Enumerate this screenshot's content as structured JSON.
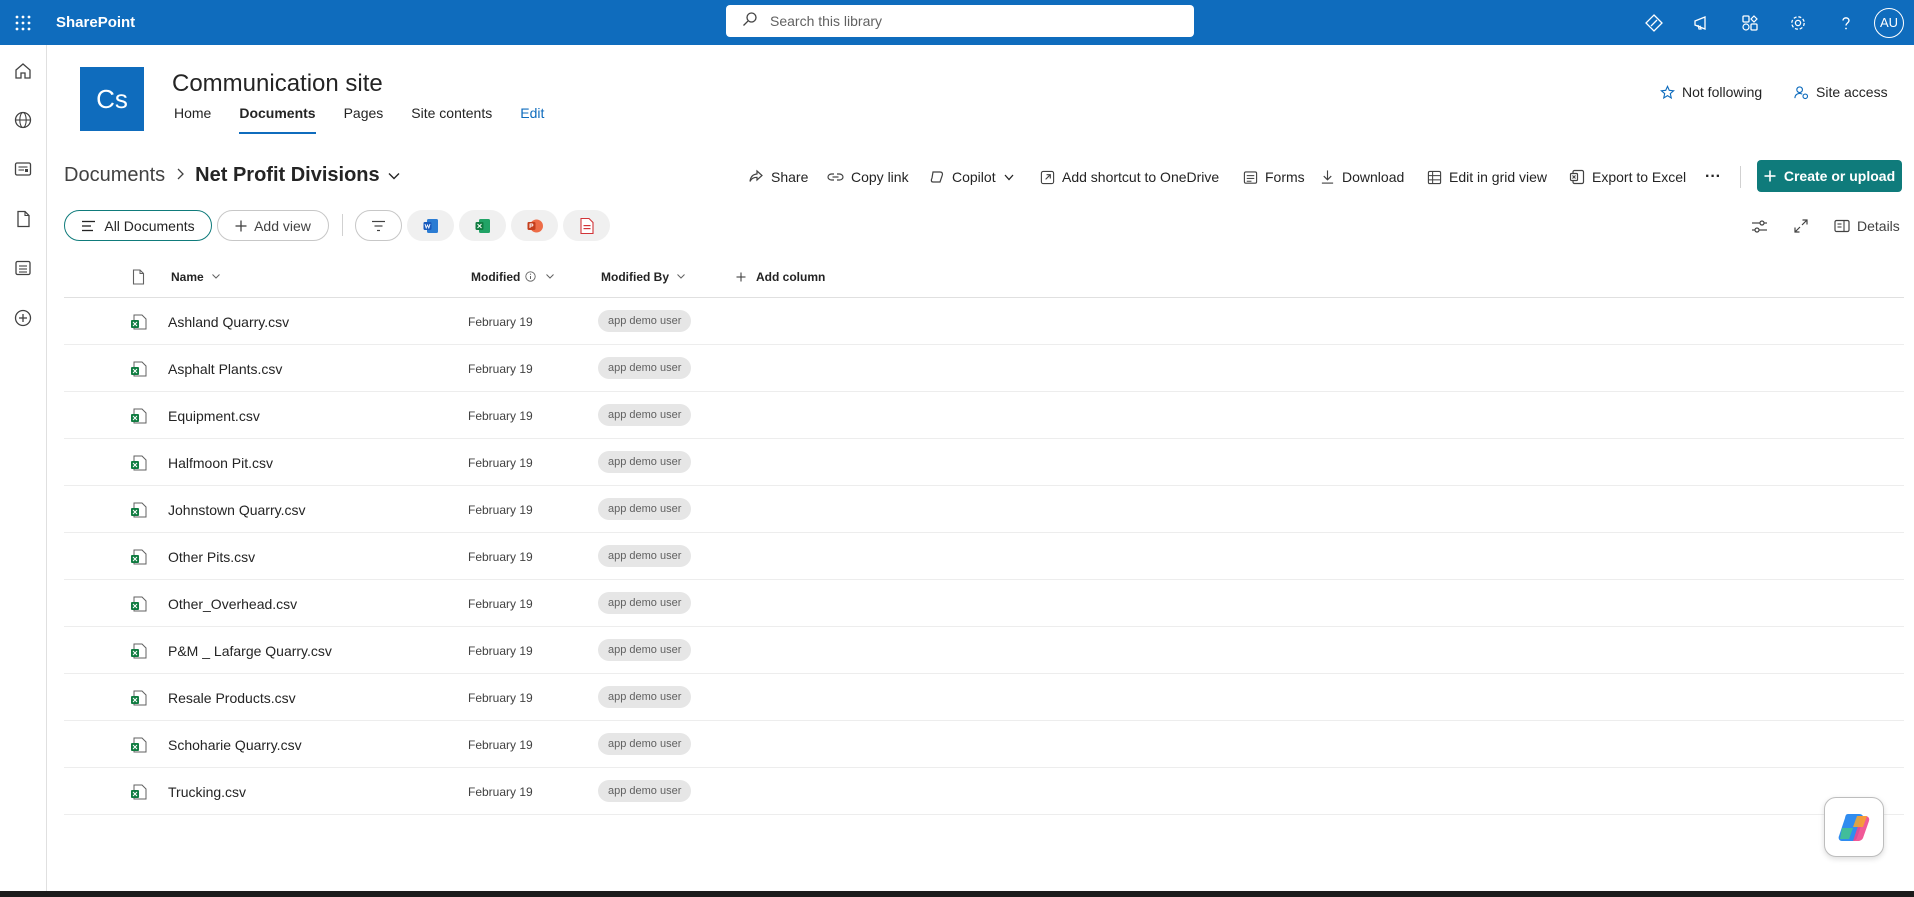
{
  "suite": {
    "brand": "SharePoint",
    "search_placeholder": "Search this library",
    "avatar_initials": "AU"
  },
  "site": {
    "logo_initials": "Cs",
    "title": "Communication site",
    "nav": [
      {
        "label": "Home",
        "active": false
      },
      {
        "label": "Documents",
        "active": true
      },
      {
        "label": "Pages",
        "active": false
      },
      {
        "label": "Site contents",
        "active": false
      },
      {
        "label": "Edit",
        "active": false
      }
    ],
    "follow_label": "Not following",
    "access_label": "Site access"
  },
  "breadcrumb": {
    "root": "Documents",
    "current": "Net Profit Divisions"
  },
  "commands": {
    "share": "Share",
    "copy_link": "Copy link",
    "copilot": "Copilot",
    "add_shortcut": "Add shortcut to OneDrive",
    "forms": "Forms",
    "download": "Download",
    "edit_grid": "Edit in grid view",
    "export_excel": "Export to Excel",
    "more": "···",
    "create_upload": "Create or upload"
  },
  "views": {
    "all_documents": "All Documents",
    "add_view": "Add view",
    "details": "Details"
  },
  "columns": {
    "name": "Name",
    "modified": "Modified",
    "modified_by": "Modified By",
    "add_column": "Add column"
  },
  "files": [
    {
      "name": "Ashland Quarry.csv",
      "modified": "February 19",
      "modified_by": "app demo user"
    },
    {
      "name": "Asphalt Plants.csv",
      "modified": "February 19",
      "modified_by": "app demo user"
    },
    {
      "name": "Equipment.csv",
      "modified": "February 19",
      "modified_by": "app demo user"
    },
    {
      "name": "Halfmoon Pit.csv",
      "modified": "February 19",
      "modified_by": "app demo user"
    },
    {
      "name": "Johnstown Quarry.csv",
      "modified": "February 19",
      "modified_by": "app demo user"
    },
    {
      "name": "Other Pits.csv",
      "modified": "February 19",
      "modified_by": "app demo user"
    },
    {
      "name": "Other_Overhead.csv",
      "modified": "February 19",
      "modified_by": "app demo user"
    },
    {
      "name": "P&M _ Lafarge Quarry.csv",
      "modified": "February 19",
      "modified_by": "app demo user"
    },
    {
      "name": "Resale Products.csv",
      "modified": "February 19",
      "modified_by": "app demo user"
    },
    {
      "name": "Schoharie Quarry.csv",
      "modified": "February 19",
      "modified_by": "app demo user"
    },
    {
      "name": "Trucking.csv",
      "modified": "February 19",
      "modified_by": "app demo user"
    }
  ],
  "colors": {
    "suitebar": "#0f6cbd",
    "accent_teal": "#0f7b7b",
    "excel_green": "#107c41"
  }
}
